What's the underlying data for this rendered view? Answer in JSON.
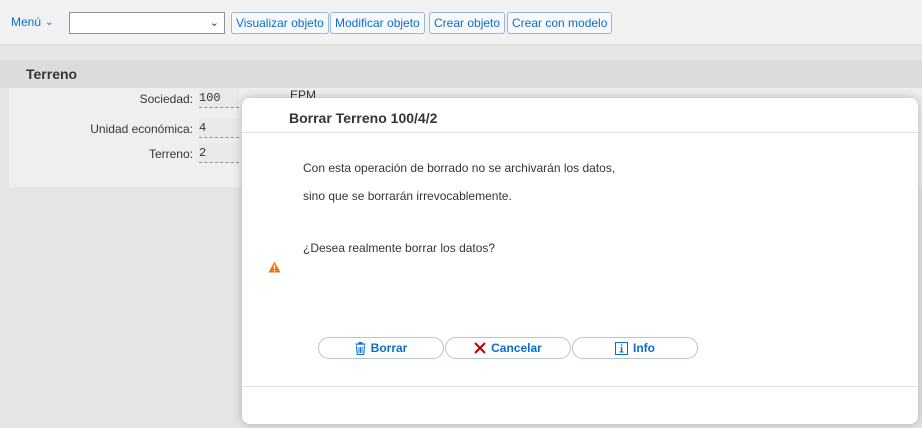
{
  "toolbar": {
    "menu_label": "Menú",
    "combo_value": "",
    "buttons": [
      "Visualizar objeto",
      "Modificar objeto",
      "Crear objeto",
      "Crear con modelo"
    ]
  },
  "section": {
    "title": "Terreno"
  },
  "form": {
    "fields": [
      {
        "label": "Sociedad:",
        "value": "100"
      },
      {
        "label": "Unidad económica:",
        "value": "4"
      },
      {
        "label": "Terreno:",
        "value": "2"
      }
    ],
    "company_desc": "EPM"
  },
  "dialog": {
    "title": "Borrar Terreno 100/4/2",
    "line1": "Con esta operación de borrado no se archivarán los datos,",
    "line2": "sino que se borrarán irrevocablemente.",
    "question": "¿Desea realmente borrar los datos?",
    "buttons": {
      "delete": "Borrar",
      "cancel": "Cancelar",
      "info": "Info"
    },
    "colors": {
      "warning": "#e9730c",
      "cancel_icon": "#bb0000",
      "accent": "#0a6ed1"
    }
  }
}
